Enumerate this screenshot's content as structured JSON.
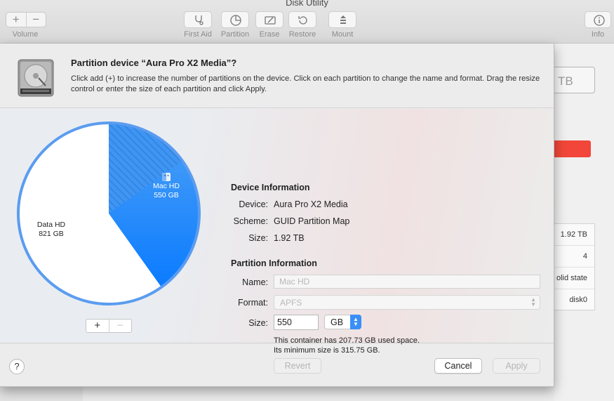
{
  "window": {
    "title": "Disk Utility"
  },
  "toolbar": {
    "volume_add": "+",
    "volume_remove": "−",
    "volume_label": "Volume",
    "first_aid_label": "First Aid",
    "partition_label": "Partition",
    "erase_label": "Erase",
    "restore_label": "Restore",
    "mount_label": "Mount",
    "info_label": "Info"
  },
  "background": {
    "capacity_fragment": "TB",
    "table_values": [
      "1.92 TB",
      "4",
      "olid state",
      "disk0"
    ]
  },
  "sheet": {
    "title": "Partition device “Aura Pro X2 Media”?",
    "description": "Click add (+) to increase the number of partitions on the device. Click on each partition to change the name and format. Drag the resize control or enter the size of each partition and click Apply."
  },
  "pie": {
    "partitions": [
      {
        "name": "Data HD",
        "size": "821 GB",
        "size_gb": 821,
        "color": "#ffffff"
      },
      {
        "name": "Mac HD",
        "size": "550 GB",
        "size_gb": 550,
        "color": "#1a8cff",
        "selected": true,
        "used_gb": 207.73
      }
    ],
    "add_label": "+",
    "remove_label": "−",
    "accent": "#5b9cf0"
  },
  "device_info": {
    "heading": "Device Information",
    "device_label": "Device:",
    "device_value": "Aura Pro X2 Media",
    "scheme_label": "Scheme:",
    "scheme_value": "GUID Partition Map",
    "size_label": "Size:",
    "size_value": "1.92 TB"
  },
  "partition_info": {
    "heading": "Partition Information",
    "name_label": "Name:",
    "name_placeholder": "Mac HD",
    "format_label": "Format:",
    "format_value": "APFS",
    "size_label": "Size:",
    "size_value": "550",
    "unit_value": "GB",
    "hint_line1": "This container has 207.73 GB used space.",
    "hint_line2": "Its minimum size is 315.75 GB."
  },
  "buttons": {
    "help": "?",
    "revert": "Revert",
    "cancel": "Cancel",
    "apply": "Apply"
  }
}
